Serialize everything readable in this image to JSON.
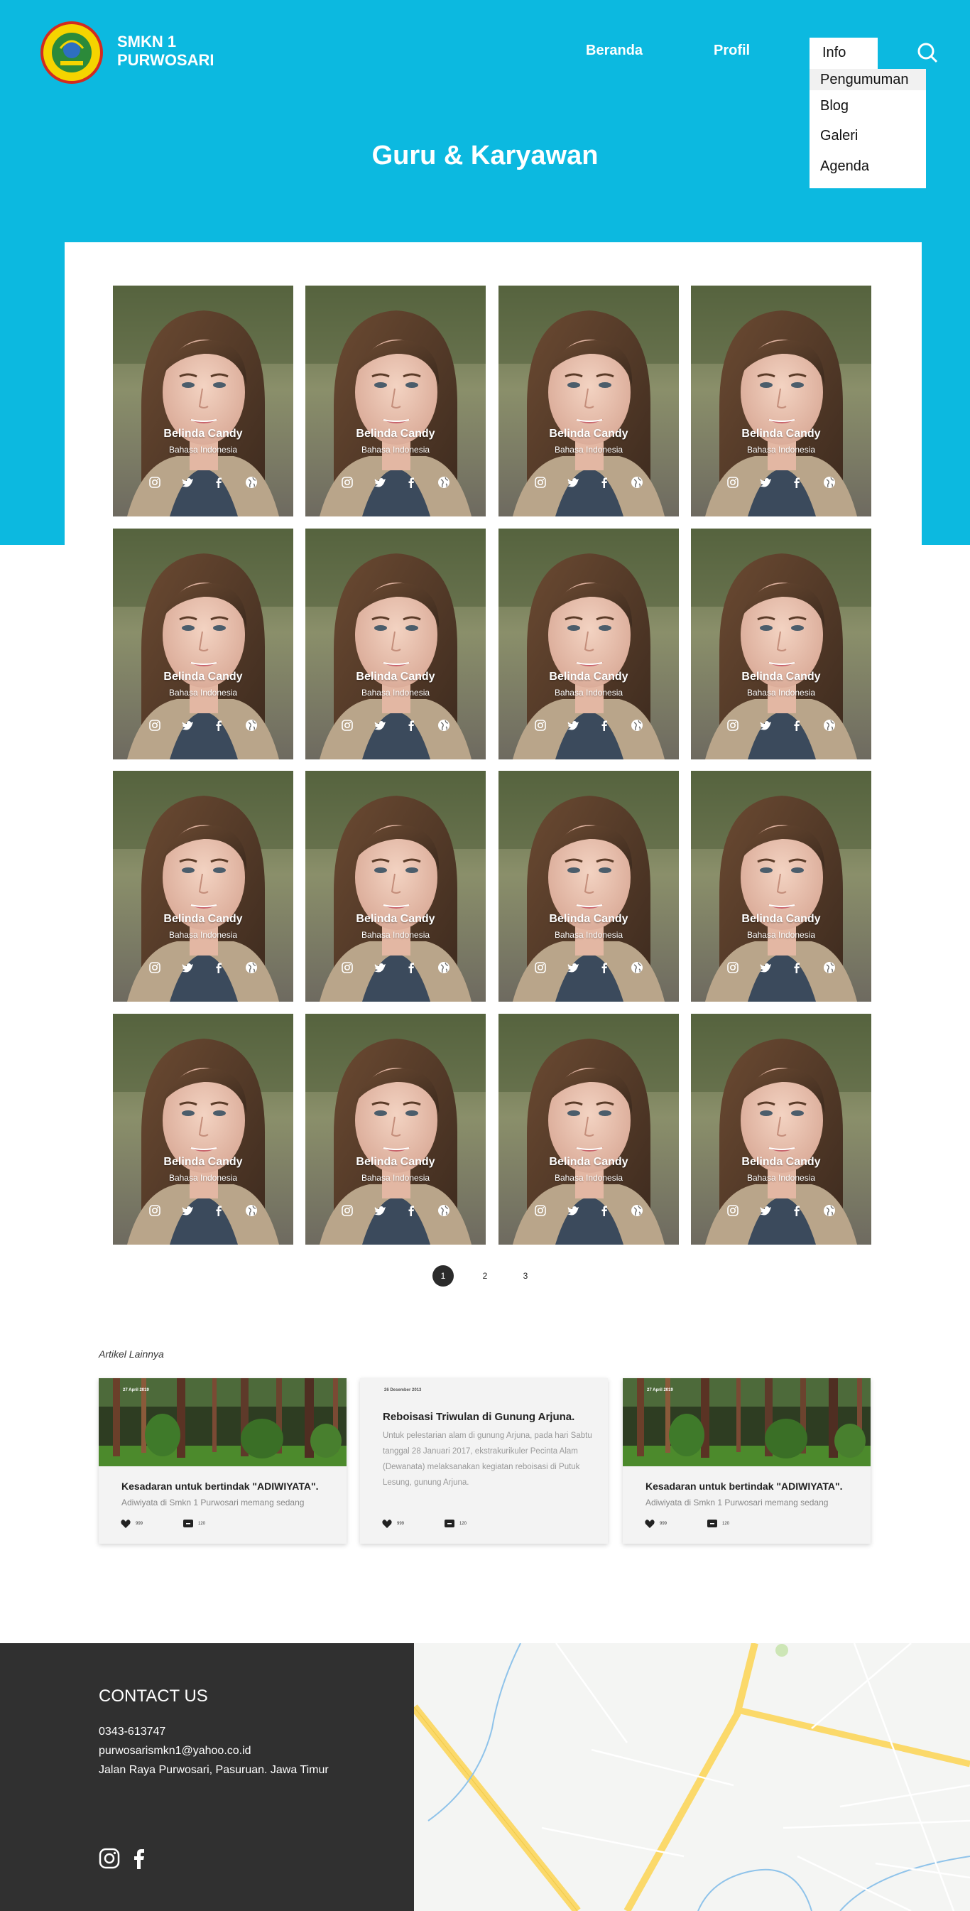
{
  "header": {
    "brand_line1": "SMKN 1",
    "brand_line2": "PURWOSARI",
    "nav": {
      "home": "Beranda",
      "profile": "Profil",
      "info": "Info"
    },
    "dropdown": [
      "Pengumuman",
      "Blog",
      "Galeri",
      "Agenda"
    ]
  },
  "hero": {
    "title": "Guru & Karyawan"
  },
  "staff": {
    "name": "Belinda Candy",
    "subject": "Bahasa Indonesia",
    "social_icons": [
      "instagram-icon",
      "twitter-icon",
      "facebook-icon",
      "globe-icon"
    ]
  },
  "pagination": {
    "pages": [
      "1",
      "2",
      "3"
    ],
    "current": "1"
  },
  "articles": {
    "section_label": "Artikel Lainnya",
    "items": [
      {
        "date": "27 April 2019",
        "title": "Kesadaran untuk bertindak \"ADIWIYATA\".",
        "excerpt": "Adiwiyata  di Smkn 1 Purwosari memang sedang",
        "likes": "999",
        "comments": "120"
      },
      {
        "date": "26 Desember 2013",
        "title": "Reboisasi Triwulan di Gunung Arjuna.",
        "excerpt": "Untuk pelestarian alam di gunung Arjuna, pada hari Sabtu tanggal 28 Januari 2017, ekstrakurikuler Pecinta Alam (Dewanata) melaksanakan kegiatan reboisasi di Putuk Lesung, gunung Arjuna.",
        "likes": "999",
        "comments": "120"
      },
      {
        "date": "27 April 2019",
        "title": "Kesadaran untuk bertindak \"ADIWIYATA\".",
        "excerpt": "Adiwiyata  di Smkn 1 Purwosari memang sedang",
        "likes": "999",
        "comments": "120"
      }
    ]
  },
  "footer": {
    "title": "CONTACT US",
    "phone": "0343-613747",
    "email": "purwosarismkn1@yahoo.co.id",
    "address": "Jalan Raya Purwosari, Pasuruan. Jawa Timur"
  },
  "colors": {
    "accent": "#0cb9e0",
    "footer": "#303030"
  }
}
